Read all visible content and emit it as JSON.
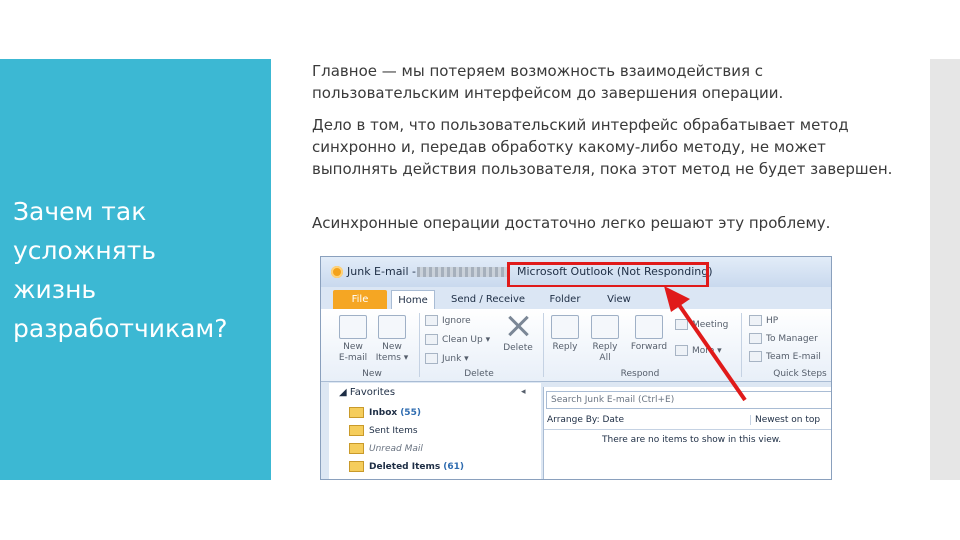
{
  "slide": {
    "title": "Зачем так\nусложнять\nжизнь\nразработчикам?",
    "paragraphs": [
      "Главное — мы потеряем возможность взаимодействия с пользовательским интерфейсом до завершения операции.",
      "Дело в том, что пользовательский интерфейс обрабатывает метод синхронно и, передав обработку какому-либо методу, не может выполнять действия пользователя, пока этот метод не будет завершен.",
      "Асинхронные операции достаточно легко решают эту проблему."
    ]
  },
  "outlook": {
    "title_prefix": "Junk E-mail -",
    "title_app": "Microsoft Outlook (Not Responding)",
    "tabs": [
      "File",
      "Home",
      "Send / Receive",
      "Folder",
      "View"
    ],
    "ribbon": {
      "new_email": "New\nE-mail",
      "new_items": "New\nItems ▾",
      "group_new": "New",
      "ignore": "Ignore",
      "clean_up": "Clean Up ▾",
      "junk": "Junk ▾",
      "delete": "Delete",
      "group_delete": "Delete",
      "reply": "Reply",
      "reply_all": "Reply\nAll",
      "forward": "Forward",
      "meeting": "Meeting",
      "more": "More ▾",
      "group_respond": "Respond",
      "hp": "HP",
      "to_manager": "To Manager",
      "team_email": "Team E-mail",
      "group_quick": "Quick Steps"
    },
    "nav": {
      "favorites": "◢ Favorites",
      "pin": "◂",
      "inbox": "Inbox",
      "inbox_count": "(55)",
      "sent": "Sent Items",
      "unread": "Unread Mail",
      "deleted": "Deleted Items",
      "deleted_count": "(61)"
    },
    "list": {
      "search_placeholder": "Search Junk E-mail (Ctrl+E)",
      "arrange": "Arrange By: Date",
      "sort": "Newest on top",
      "empty": "There are no items to show in this view."
    }
  },
  "colors": {
    "panel": "#3cb8d3",
    "highlight": "#e01a1a",
    "file_tab": "#f5a623"
  }
}
